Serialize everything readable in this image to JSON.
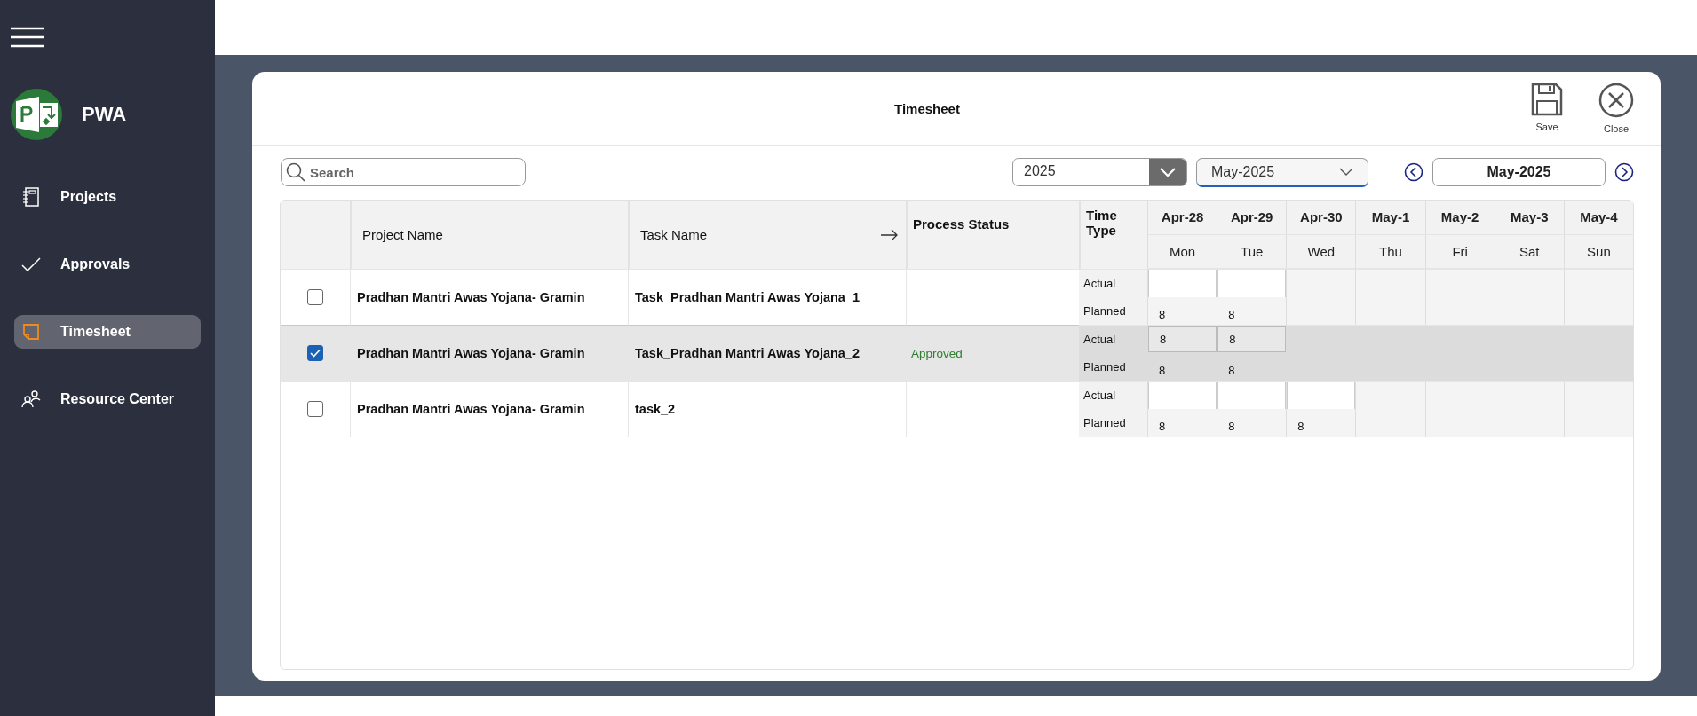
{
  "app": {
    "name": "PWA"
  },
  "sidebar": {
    "items": [
      {
        "label": "Projects",
        "selected": false
      },
      {
        "label": "Approvals",
        "selected": false
      },
      {
        "label": "Timesheet",
        "selected": true
      },
      {
        "label": "Resource Center",
        "selected": false
      }
    ]
  },
  "dialog": {
    "title": "Timesheet",
    "actions": [
      {
        "label": "Save",
        "kind": "save"
      },
      {
        "label": "Close",
        "kind": "close"
      }
    ]
  },
  "toolbar": {
    "search": {
      "placeholder": "Search"
    },
    "year": "2025",
    "month": "May-2025",
    "period": "May-2025"
  },
  "table": {
    "columns": [
      "Project Name",
      "Task Name",
      "Process Status",
      "Time Type"
    ],
    "days": [
      {
        "date": "Apr-28",
        "weekday": "Mon"
      },
      {
        "date": "Apr-29",
        "weekday": "Tue"
      },
      {
        "date": "Apr-30",
        "weekday": "Wed"
      },
      {
        "date": "May-1",
        "weekday": "Thu"
      },
      {
        "date": "May-2",
        "weekday": "Fri"
      },
      {
        "date": "May-3",
        "weekday": "Sat"
      },
      {
        "date": "May-4",
        "weekday": "Sun"
      }
    ],
    "rows": [
      {
        "checked": false,
        "project": "Pradhan Mantri Awas Yojana- Gramin",
        "task": "Task_Pradhan Mantri Awas Yojana_1",
        "time_types": [
          "Actual",
          "Planned"
        ],
        "actual": [
          {
            "editable": true
          },
          {
            "editable": true
          },
          {
            "editable": false
          },
          {
            "editable": false
          },
          {
            "editable": false
          },
          {
            "editable": false
          },
          {
            "editable": false
          }
        ],
        "planned": [
          "8",
          "8"
        ]
      },
      {
        "checked": true,
        "project": "Pradhan Mantri Awas Yojana- Gramin",
        "task": "Task_Pradhan Mantri Awas Yojana_2",
        "status": "Approved",
        "time_types": [
          "Actual",
          "Planned"
        ],
        "actual": [
          {
            "editable": true,
            "value": "8"
          },
          {
            "editable": true,
            "value": "8"
          },
          {
            "editable": false
          },
          {
            "editable": false
          },
          {
            "editable": false
          },
          {
            "editable": false
          },
          {
            "editable": false
          }
        ],
        "planned": [
          "8",
          "8"
        ]
      },
      {
        "checked": false,
        "project": "Pradhan Mantri Awas Yojana- Gramin",
        "task": "task_2",
        "time_types": [
          "Actual",
          "Planned"
        ],
        "actual": [
          {
            "editable": true
          },
          {
            "editable": true
          },
          {
            "editable": true
          },
          {
            "editable": false
          },
          {
            "editable": false
          },
          {
            "editable": false
          },
          {
            "editable": false
          }
        ],
        "planned": [
          "8",
          "8",
          "8"
        ]
      }
    ]
  }
}
